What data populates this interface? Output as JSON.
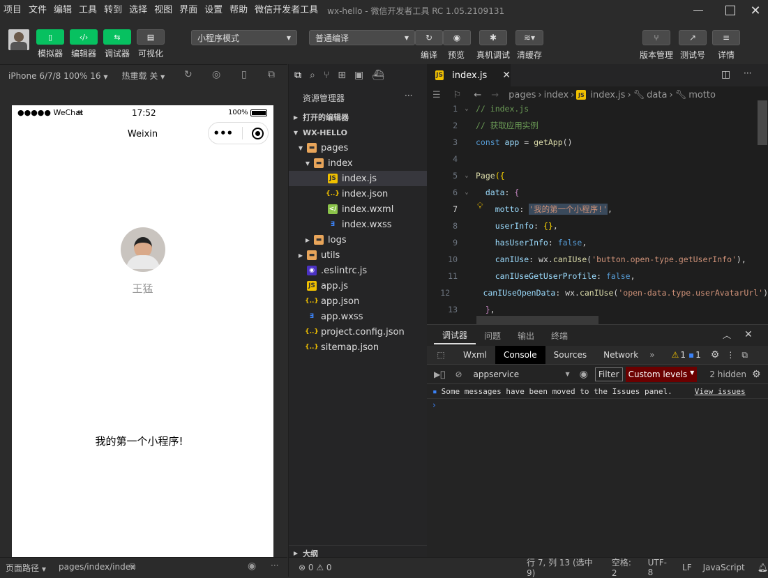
{
  "menubar": {
    "items": [
      "项目",
      "文件",
      "编辑",
      "工具",
      "转到",
      "选择",
      "视图",
      "界面",
      "设置",
      "帮助",
      "微信开发者工具"
    ],
    "title": "wx-hello - 微信开发者工具 RC 1.05.2109131"
  },
  "toolbar": {
    "simulator": "模拟器",
    "editor": "编辑器",
    "debugger": "调试器",
    "visual": "可视化",
    "mode_select": "小程序模式",
    "compile_select": "普通编译",
    "compile": "编译",
    "preview": "预览",
    "real_debug": "真机调试",
    "clear_cache": "清缓存",
    "version": "版本管理",
    "test_account": "测试号",
    "details": "详情"
  },
  "simbar": {
    "device": "iPhone 6/7/8 100% 16",
    "hot_reload": "热重载 关"
  },
  "phone": {
    "signal": "●●●●● WeChat",
    "time": "17:52",
    "battery": "100%",
    "nav_title": "Weixin",
    "nav_capsule_dots": "•••",
    "nickname": "王猛",
    "motto": "我的第一个小程序!"
  },
  "statusbar_left": {
    "page_path_label": "页面路径",
    "page_path": "pages/index/index"
  },
  "explorer": {
    "title": "资源管理器",
    "more": "···",
    "open_editors": "打开的编辑器",
    "project": "WX-HELLO",
    "tree": [
      {
        "name": "pages",
        "icon": "folder-icon",
        "depth": 1,
        "arrow": "▾"
      },
      {
        "name": "index",
        "icon": "folder-icon",
        "depth": 2,
        "arrow": "▾"
      },
      {
        "name": "index.js",
        "icon": "js-file-icon",
        "depth": 3,
        "arrow": ""
      },
      {
        "name": "index.json",
        "icon": "json-file-icon",
        "depth": 3,
        "arrow": ""
      },
      {
        "name": "index.wxml",
        "icon": "wxml-file-icon",
        "depth": 3,
        "arrow": ""
      },
      {
        "name": "index.wxss",
        "icon": "wxss-file-icon",
        "depth": 3,
        "arrow": ""
      },
      {
        "name": "logs",
        "icon": "folder-icon",
        "depth": 2,
        "arrow": "▸"
      },
      {
        "name": "utils",
        "icon": "folder-icon",
        "depth": 1,
        "arrow": "▸"
      },
      {
        "name": ".eslintrc.js",
        "icon": "eslint-file-icon",
        "depth": 1,
        "arrow": ""
      },
      {
        "name": "app.js",
        "icon": "js-file-icon",
        "depth": 1,
        "arrow": ""
      },
      {
        "name": "app.json",
        "icon": "json-file-icon",
        "depth": 1,
        "arrow": ""
      },
      {
        "name": "app.wxss",
        "icon": "wxss-file-icon",
        "depth": 1,
        "arrow": ""
      },
      {
        "name": "project.config.json",
        "icon": "json-file-icon",
        "depth": 1,
        "arrow": ""
      },
      {
        "name": "sitemap.json",
        "icon": "json-file-icon",
        "depth": 1,
        "arrow": ""
      }
    ],
    "outline": "大纲",
    "problems": "⊗ 0 ⚠ 0"
  },
  "editor": {
    "tab": "index.js",
    "crumbs": [
      "pages",
      "index",
      "index.js",
      "data",
      "motto"
    ],
    "lines": [
      {
        "n": "1",
        "parts": [
          [
            "cm",
            "// index.js"
          ]
        ]
      },
      {
        "n": "2",
        "parts": [
          [
            "cm",
            "// 获取应用实例"
          ]
        ]
      },
      {
        "n": "3",
        "parts": [
          [
            "kw2",
            "const "
          ],
          [
            "pr",
            "app"
          ],
          [
            "wt",
            " = "
          ],
          [
            "fn",
            "getApp"
          ],
          [
            "wt",
            "()"
          ]
        ]
      },
      {
        "n": "4",
        "parts": []
      },
      {
        "n": "5",
        "parts": [
          [
            "fn",
            "Page"
          ],
          [
            "br",
            "({"
          ]
        ]
      },
      {
        "n": "6",
        "parts": [
          [
            "pr",
            "  data"
          ],
          [
            "wt",
            ": "
          ],
          [
            "kw",
            "{"
          ]
        ]
      },
      {
        "n": "7",
        "parts": [
          [
            "pr",
            "    motto"
          ],
          [
            "wt",
            ": "
          ],
          [
            "str",
            "'我的第一个小程序!'"
          ],
          [
            "wt",
            ","
          ]
        ]
      },
      {
        "n": "8",
        "parts": [
          [
            "pr",
            "    userInfo"
          ],
          [
            "wt",
            ": "
          ],
          [
            "br",
            "{}"
          ],
          [
            "wt",
            ","
          ]
        ]
      },
      {
        "n": "9",
        "parts": [
          [
            "pr",
            "    hasUserInfo"
          ],
          [
            "wt",
            ": "
          ],
          [
            "kw2",
            "false"
          ],
          [
            "wt",
            ","
          ]
        ]
      },
      {
        "n": "10",
        "parts": [
          [
            "pr",
            "    canIUse"
          ],
          [
            "wt",
            ": wx."
          ],
          [
            "fn",
            "canIUse"
          ],
          [
            "wt",
            "("
          ],
          [
            "str",
            "'button.open-type.getUserInfo'"
          ],
          [
            "wt",
            "),"
          ]
        ]
      },
      {
        "n": "11",
        "parts": [
          [
            "pr",
            "    canIUseGetUserProfile"
          ],
          [
            "wt",
            ": "
          ],
          [
            "kw2",
            "false"
          ],
          [
            "wt",
            ","
          ]
        ]
      },
      {
        "n": "12",
        "parts": [
          [
            "pr",
            "    canIUseOpenData"
          ],
          [
            "wt",
            ": wx."
          ],
          [
            "fn",
            "canIUse"
          ],
          [
            "wt",
            "("
          ],
          [
            "str",
            "'open-data.type.userAvatarUrl'"
          ],
          [
            "wt",
            ")"
          ]
        ]
      },
      {
        "n": "13",
        "parts": [
          [
            "kw",
            "  }"
          ],
          [
            "wt",
            ","
          ]
        ]
      }
    ]
  },
  "devtools": {
    "top_tabs": [
      "调试器",
      "问题",
      "输出",
      "终端"
    ],
    "tabs": [
      "Wxml",
      "Console",
      "Sources",
      "Network"
    ],
    "warn_count": "1",
    "info_count": "1",
    "context": "appservice",
    "filter": "Filter",
    "levels": "Custom levels",
    "hidden": "2 hidden",
    "message": "Some messages have been moved to the Issues panel.",
    "view_issues": "View issues"
  },
  "statusbar_right": {
    "position": "行 7, 列 13 (选中 9)",
    "spaces": "空格: 2",
    "encoding": "UTF-8",
    "eol": "LF",
    "language": "JavaScript"
  }
}
